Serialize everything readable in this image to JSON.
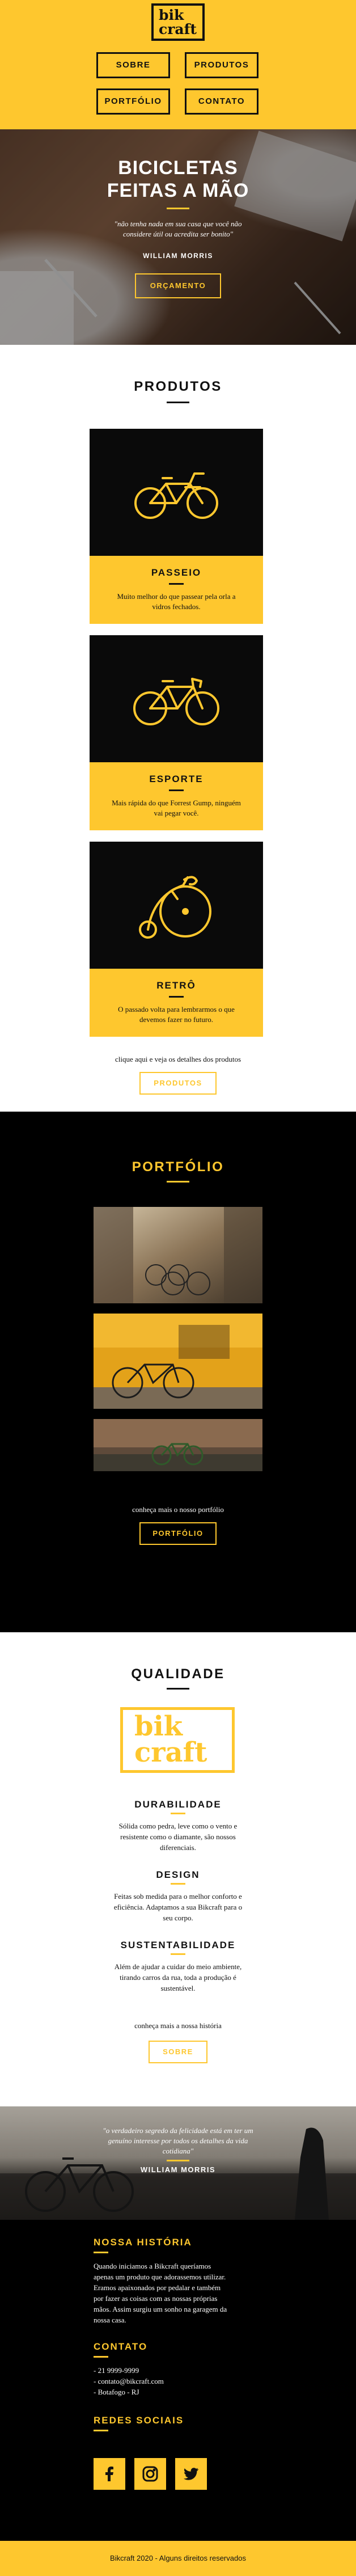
{
  "header": {
    "logo": {
      "line1": "bik",
      "line2": "craft"
    },
    "nav": [
      "SOBRE",
      "PRODUTOS",
      "PORTFÓLIO",
      "CONTATO"
    ]
  },
  "hero": {
    "title_line1": "BICICLETAS",
    "title_line2": "FEITAS A MÃO",
    "quote": "\"não tenha nada em sua casa que você não considere útil ou acredita ser bonito\"",
    "author": "WILLIAM MORRIS",
    "button": "ORÇAMENTO"
  },
  "produtos": {
    "title": "PRODUTOS",
    "items": [
      {
        "name": "PASSEIO",
        "desc": "Muito melhor do que passear pela orla a vidros fechados.",
        "icon": "cruiser-bike-icon"
      },
      {
        "name": "ESPORTE",
        "desc": "Mais rápida do que Forrest Gump, ninguém vai pegar você.",
        "icon": "road-bike-icon"
      },
      {
        "name": "RETRÔ",
        "desc": "O passado volta para lembrarmos o que devemos fazer no futuro.",
        "icon": "penny-farthing-icon"
      }
    ],
    "more": "clique aqui e veja os detalhes dos produtos",
    "button": "PRODUTOS"
  },
  "portfolio": {
    "title": "PORTFÓLIO",
    "more": "conheça mais o nosso portfólio",
    "button": "PORTFÓLIO"
  },
  "qualidade": {
    "title": "QUALIDADE",
    "logo": {
      "line1": "bik",
      "line2": "craft"
    },
    "items": [
      {
        "title": "DURABILIDADE",
        "desc": "Sólida como pedra, leve como o vento e resistente como o diamante, são nossos diferenciais."
      },
      {
        "title": "DESIGN",
        "desc": "Feitas sob medida para o melhor conforto e eficiência. Adaptamos a sua Bikcraft para o seu corpo."
      },
      {
        "title": "SUSTENTABILIDADE",
        "desc": "Além de ajudar a cuidar do meio ambiente, tirando carros da rua, toda a produção é sustentável."
      }
    ],
    "more": "conheça mais a nossa história",
    "button": "SOBRE"
  },
  "band": {
    "quote": "\"o verdadeiro segredo da felicidade está em ter um genuíno interesse por todos os detalhes da vida cotidiana\"",
    "author": "WILLIAM MORRIS"
  },
  "footer": {
    "history_title": "NOSSA HISTÓRIA",
    "history": "Quando iniciamos a Bikcraft queríamos apenas um produto que adorassemos utilizar. Eramos apaixonados por pedalar e também por fazer as coisas com as nossas próprias mãos. Assim surgiu um sonho na garagem da nossa casa.",
    "contact_title": "CONTATO",
    "contacts": [
      "- 21 9999-9999",
      "- contato@bikcraft.com",
      "- Botafogo - RJ"
    ],
    "social_title": "REDES SOCIAIS",
    "social": [
      "facebook-icon",
      "instagram-icon",
      "twitter-icon"
    ],
    "copyright": "Bikcraft 2020 - Alguns direitos reservados"
  },
  "colors": {
    "accent": "#fec72e",
    "dark": "#000000"
  }
}
